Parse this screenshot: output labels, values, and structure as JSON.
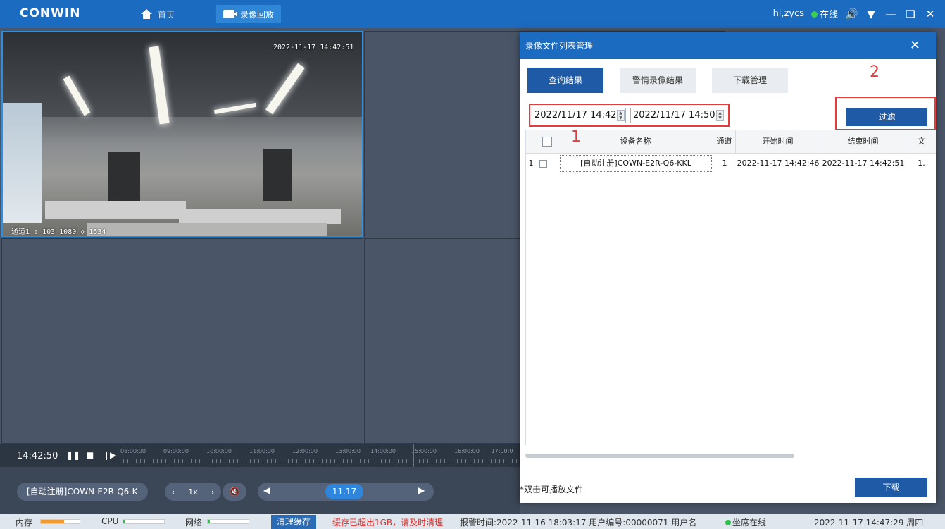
{
  "app": {
    "logo": "CONWIN",
    "nav": {
      "home": "首页",
      "playback": "录像回放"
    },
    "user": "hi,zycs",
    "status": "在线"
  },
  "video": {
    "osd_time": "2022-11-17 14:42:51",
    "osd_channel": "通道1 : 103 1080 ◇ 1534"
  },
  "timeline": {
    "current_time": "14:42:50",
    "ticks": [
      "08:00:00",
      "09:00:00",
      "10:00:00",
      "11:00:00",
      "12:00:00",
      "13:00:00",
      "14:00:00",
      "15:00:00",
      "16:00:00",
      "17:00:0"
    ]
  },
  "playback": {
    "device": "[自动注册]COWN-E2R-Q6-K",
    "speed": "1x",
    "date": "11.17"
  },
  "statusbar": {
    "mem_label": "内存",
    "cpu_label": "CPU",
    "net_label": "网络",
    "mem_level": 0.6,
    "cpu_level": 0.05,
    "net_level": 0.05,
    "clear_cache": "清理缓存",
    "cache_warning": "缓存已超出1GB，请及时清理",
    "alarm_info": "报警时间:2022-11-16 18:03:17  用户编号:00000071  用户名",
    "seat_status": "坐席在线",
    "datetime": "2022-11-17 14:47:29 周四"
  },
  "dialog": {
    "title": "录像文件列表管理",
    "tabs": [
      "查询结果",
      "警情录像结果",
      "下载管理"
    ],
    "start_time": "2022/11/17 14:42",
    "end_time": "2022/11/17 14:50",
    "filter": "过滤",
    "annotation_1": "1",
    "annotation_2": "2",
    "columns": [
      "设备名称",
      "通道",
      "开始时间",
      "结束时间",
      "文"
    ],
    "rows": [
      {
        "index": "1",
        "device": "[自动注册]COWN-E2R-Q6-KKL",
        "channel": "1",
        "start": "2022-11-17 14:42:46",
        "end": "2022-11-17 14:42:51",
        "file": "1."
      }
    ],
    "hint": "*双击可播放文件",
    "download": "下载"
  },
  "colors": {
    "titlebar": "#1b6bc0",
    "primary_button": "#1f5aa6",
    "annotation": "#e83a3a",
    "online": "#3ccf4e"
  }
}
